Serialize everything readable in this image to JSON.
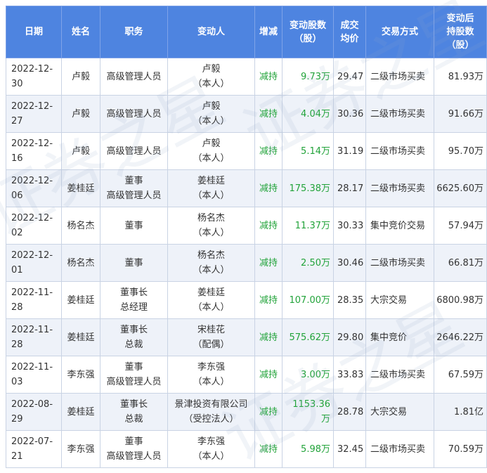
{
  "table": {
    "headers": {
      "date": "日期",
      "name": "姓名",
      "position": "职务",
      "changer": "变动人",
      "direction": "增减",
      "change_shares": [
        "变动股数",
        "（股）"
      ],
      "avg_price": [
        "成交",
        "均价"
      ],
      "method": "交易方式",
      "after_shares": [
        "变动后",
        "持股数",
        "（股）"
      ]
    },
    "rows": [
      {
        "date": "2022-12-30",
        "name": "卢毅",
        "position": [
          "高级管理人员"
        ],
        "changer": [
          "卢毅",
          "（本人）"
        ],
        "direction": "减持",
        "change": "9.73万",
        "price": "29.47",
        "method": "二级市场买卖",
        "after": "81.93万"
      },
      {
        "date": "2022-12-27",
        "name": "卢毅",
        "position": [
          "高级管理人员"
        ],
        "changer": [
          "卢毅",
          "（本人）"
        ],
        "direction": "减持",
        "change": "4.04万",
        "price": "30.36",
        "method": "二级市场买卖",
        "after": "91.66万"
      },
      {
        "date": "2022-12-16",
        "name": "卢毅",
        "position": [
          "高级管理人员"
        ],
        "changer": [
          "卢毅",
          "（本人）"
        ],
        "direction": "减持",
        "change": "5.14万",
        "price": "31.19",
        "method": "二级市场买卖",
        "after": "95.70万"
      },
      {
        "date": "2022-12-06",
        "name": "姜桂廷",
        "position": [
          "董事",
          "高级管理人员"
        ],
        "changer": [
          "姜桂廷",
          "（本人）"
        ],
        "direction": "减持",
        "change": "175.38万",
        "price": "28.17",
        "method": "二级市场买卖",
        "after": "6625.60万"
      },
      {
        "date": "2022-12-02",
        "name": "杨名杰",
        "position": [
          "董事"
        ],
        "changer": [
          "杨名杰",
          "（本人）"
        ],
        "direction": "减持",
        "change": "11.37万",
        "price": "30.33",
        "method": "集中竞价交易",
        "after": "57.94万"
      },
      {
        "date": "2022-12-01",
        "name": "杨名杰",
        "position": [
          "董事"
        ],
        "changer": [
          "杨名杰",
          "（本人）"
        ],
        "direction": "减持",
        "change": "2.50万",
        "price": "30.46",
        "method": "二级市场买卖",
        "after": "66.81万"
      },
      {
        "date": "2022-11-28",
        "name": "姜桂廷",
        "position": [
          "董事长",
          "总经理"
        ],
        "changer": [
          "姜桂廷",
          "（本人）"
        ],
        "direction": "减持",
        "change": "107.00万",
        "price": "28.35",
        "method": "大宗交易",
        "after": "6800.98万"
      },
      {
        "date": "2022-11-28",
        "name": "姜桂廷",
        "position": [
          "董事长",
          "总裁"
        ],
        "changer": [
          "宋桂花",
          "（配偶）"
        ],
        "direction": "减持",
        "change": "575.62万",
        "price": "29.80",
        "method": "集中竞价",
        "after": "2646.22万"
      },
      {
        "date": "2022-11-03",
        "name": "李东强",
        "position": [
          "董事",
          "高级管理人员"
        ],
        "changer": [
          "李东强",
          "（本人）"
        ],
        "direction": "减持",
        "change": "3.00万",
        "price": "33.83",
        "method": "二级市场买卖",
        "after": "67.59万"
      },
      {
        "date": "2022-08-29",
        "name": "姜桂廷",
        "position": [
          "董事长",
          "总裁"
        ],
        "changer": [
          "景津投资有限公司",
          "（受控法人）"
        ],
        "direction": "减持",
        "change": "1153.36万",
        "price": "28.78",
        "method": "大宗交易",
        "after": "1.81亿"
      },
      {
        "date": "2022-07-21",
        "name": "李东强",
        "position": [
          "董事",
          "高级管理人员"
        ],
        "changer": [
          "李东强",
          "（本人）"
        ],
        "direction": "减持",
        "change": "5.98万",
        "price": "32.45",
        "method": "二级市场买卖",
        "after": "70.59万"
      }
    ]
  },
  "watermark": "证券之星",
  "colors": {
    "header_bg": "#4e84e0",
    "direction_text": "#22a33a",
    "row_shade": "#eef2f9"
  }
}
